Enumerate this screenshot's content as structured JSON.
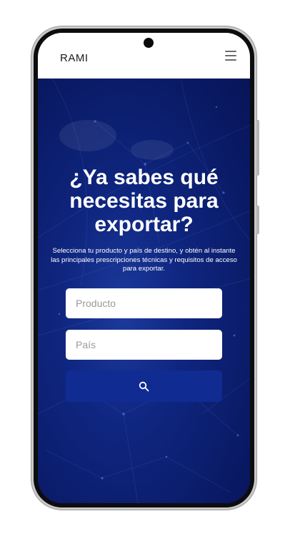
{
  "header": {
    "logo_text": "RAMI"
  },
  "hero": {
    "title": "¿Ya sabes qué necesitas para exportar?",
    "subtitle": "Selecciona tu producto y país de destino, y obtén al instante las principales prescripciones técnicas y requisitos de acceso para exportar."
  },
  "search": {
    "product_placeholder": "Producto",
    "country_placeholder": "País",
    "button_icon": "search-icon"
  },
  "colors": {
    "hero_background": "#0b1f73",
    "button_background": "#102b91",
    "header_background": "#ffffff"
  }
}
